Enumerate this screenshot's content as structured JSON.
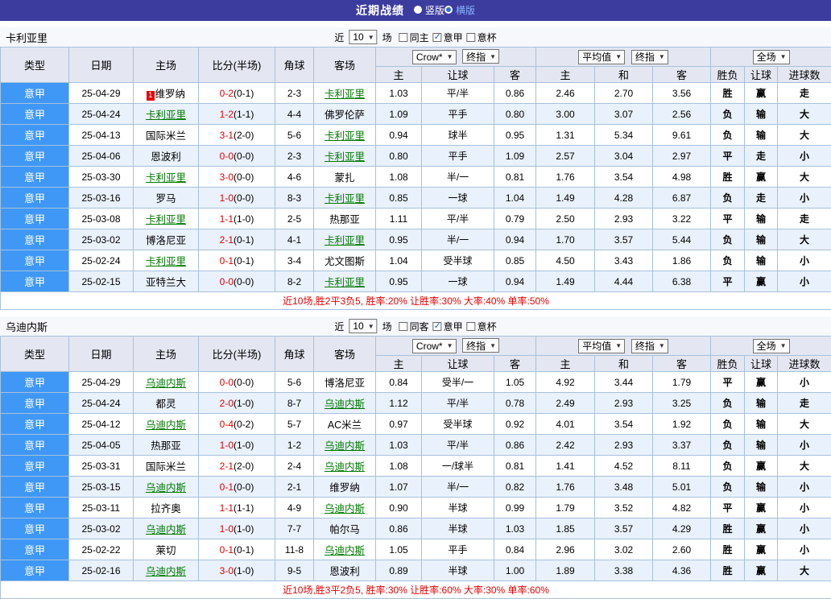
{
  "topbar": {
    "title": "近期战绩",
    "modes": [
      {
        "label": "竖版",
        "selected": false
      },
      {
        "label": "横版",
        "selected": true
      }
    ]
  },
  "controls": {
    "near": "近",
    "count": "10",
    "games": "场"
  },
  "table_head": {
    "type": "类型",
    "date": "日期",
    "home": "主场",
    "score": "比分(半场)",
    "corner": "角球",
    "away": "客场",
    "dropdown_bookmaker": "Crow*",
    "dropdown_final": "终指",
    "dropdown_average": "平均值",
    "dropdown_final2": "终指",
    "dropdown_fullmatch": "全场",
    "sub": [
      "主",
      "让球",
      "客",
      "主",
      "和",
      "客",
      "胜负",
      "让球",
      "进球数"
    ]
  },
  "colors": {
    "accent_bar": "#3c3c9e",
    "league_bg": "#3f98f6",
    "win": "#e60012",
    "lose": "#2525cc",
    "draw": "#00a04a",
    "focus_team": "#007a00",
    "summary": "#e60000"
  },
  "sections": [
    {
      "team": "卡利亚里",
      "filters": [
        {
          "label": "同主",
          "checked": false
        },
        {
          "label": "意甲",
          "checked": true
        },
        {
          "label": "意杯",
          "checked": false
        }
      ],
      "summary": "近10场,胜2平3负5, 胜率:20% 让胜率:30% 大率:40% 单率:50%",
      "rows": [
        {
          "league": "意甲",
          "date": "25-04-29",
          "home": {
            "name": "维罗纳",
            "focus": false,
            "badge": "1"
          },
          "score": "0-2",
          "half": "(0-1)",
          "corner": "2-3",
          "away": {
            "name": "卡利亚里",
            "focus": true
          },
          "odds": [
            "1.03",
            "平/半",
            "0.86"
          ],
          "avg": [
            "2.46",
            "2.70",
            "3.56"
          ],
          "result": [
            [
              "胜",
              "w"
            ],
            [
              "赢",
              "w"
            ],
            [
              "走",
              "d"
            ]
          ]
        },
        {
          "league": "意甲",
          "date": "25-04-24",
          "home": {
            "name": "卡利亚里",
            "focus": true
          },
          "score": "1-2",
          "half": "(1-1)",
          "corner": "4-4",
          "away": {
            "name": "佛罗伦萨",
            "focus": false
          },
          "odds": [
            "1.09",
            "平手",
            "0.80"
          ],
          "avg": [
            "3.00",
            "3.07",
            "2.56"
          ],
          "result": [
            [
              "负",
              "l"
            ],
            [
              "输",
              "l"
            ],
            [
              "大",
              "w"
            ]
          ]
        },
        {
          "league": "意甲",
          "date": "25-04-13",
          "home": {
            "name": "国际米兰",
            "focus": false
          },
          "score": "3-1",
          "half": "(2-0)",
          "corner": "5-6",
          "away": {
            "name": "卡利亚里",
            "focus": true
          },
          "odds": [
            "0.94",
            "球半",
            "0.95"
          ],
          "avg": [
            "1.31",
            "5.34",
            "9.61"
          ],
          "result": [
            [
              "负",
              "l"
            ],
            [
              "输",
              "l"
            ],
            [
              "大",
              "w"
            ]
          ]
        },
        {
          "league": "意甲",
          "date": "25-04-06",
          "home": {
            "name": "恩波利",
            "focus": false
          },
          "score": "0-0",
          "half": "(0-0)",
          "corner": "2-3",
          "away": {
            "name": "卡利亚里",
            "focus": true
          },
          "odds": [
            "0.80",
            "平手",
            "1.09"
          ],
          "avg": [
            "2.57",
            "3.04",
            "2.97"
          ],
          "result": [
            [
              "平",
              "d"
            ],
            [
              "走",
              "d"
            ],
            [
              "小",
              "l"
            ]
          ]
        },
        {
          "league": "意甲",
          "date": "25-03-30",
          "home": {
            "name": "卡利亚里",
            "focus": true
          },
          "score": "3-0",
          "half": "(0-0)",
          "corner": "4-6",
          "away": {
            "name": "蒙扎",
            "focus": false
          },
          "odds": [
            "1.08",
            "半/一",
            "0.81"
          ],
          "avg": [
            "1.76",
            "3.54",
            "4.98"
          ],
          "result": [
            [
              "胜",
              "w"
            ],
            [
              "赢",
              "w"
            ],
            [
              "大",
              "w"
            ]
          ]
        },
        {
          "league": "意甲",
          "date": "25-03-16",
          "home": {
            "name": "罗马",
            "focus": false
          },
          "score": "1-0",
          "half": "(0-0)",
          "corner": "8-3",
          "away": {
            "name": "卡利亚里",
            "focus": true
          },
          "odds": [
            "0.85",
            "一球",
            "1.04"
          ],
          "avg": [
            "1.49",
            "4.28",
            "6.87"
          ],
          "result": [
            [
              "负",
              "l"
            ],
            [
              "走",
              "d"
            ],
            [
              "小",
              "l"
            ]
          ]
        },
        {
          "league": "意甲",
          "date": "25-03-08",
          "home": {
            "name": "卡利亚里",
            "focus": true
          },
          "score": "1-1",
          "half": "(1-0)",
          "corner": "2-5",
          "away": {
            "name": "热那亚",
            "focus": false
          },
          "odds": [
            "1.11",
            "平/半",
            "0.79"
          ],
          "avg": [
            "2.50",
            "2.93",
            "3.22"
          ],
          "result": [
            [
              "平",
              "d"
            ],
            [
              "输",
              "l"
            ],
            [
              "走",
              "d"
            ]
          ]
        },
        {
          "league": "意甲",
          "date": "25-03-02",
          "home": {
            "name": "博洛尼亚",
            "focus": false
          },
          "score": "2-1",
          "half": "(0-1)",
          "corner": "4-1",
          "away": {
            "name": "卡利亚里",
            "focus": true
          },
          "odds": [
            "0.95",
            "半/一",
            "0.94"
          ],
          "avg": [
            "1.70",
            "3.57",
            "5.44"
          ],
          "result": [
            [
              "负",
              "l"
            ],
            [
              "输",
              "l"
            ],
            [
              "大",
              "w"
            ]
          ]
        },
        {
          "league": "意甲",
          "date": "25-02-24",
          "home": {
            "name": "卡利亚里",
            "focus": true
          },
          "score": "0-1",
          "half": "(0-1)",
          "corner": "3-4",
          "away": {
            "name": "尤文图斯",
            "focus": false
          },
          "odds": [
            "1.04",
            "受半球",
            "0.85"
          ],
          "avg": [
            "4.50",
            "3.43",
            "1.86"
          ],
          "result": [
            [
              "负",
              "l"
            ],
            [
              "输",
              "l"
            ],
            [
              "小",
              "l"
            ]
          ]
        },
        {
          "league": "意甲",
          "date": "25-02-15",
          "home": {
            "name": "亚特兰大",
            "focus": false
          },
          "score": "0-0",
          "half": "(0-0)",
          "corner": "8-2",
          "away": {
            "name": "卡利亚里",
            "focus": true
          },
          "odds": [
            "0.95",
            "一球",
            "0.94"
          ],
          "avg": [
            "1.49",
            "4.44",
            "6.38"
          ],
          "result": [
            [
              "平",
              "d"
            ],
            [
              "赢",
              "w"
            ],
            [
              "小",
              "l"
            ]
          ]
        }
      ]
    },
    {
      "team": "乌迪内斯",
      "filters": [
        {
          "label": "同客",
          "checked": false
        },
        {
          "label": "意甲",
          "checked": true
        },
        {
          "label": "意杯",
          "checked": false
        }
      ],
      "summary": "近10场,胜3平2负5, 胜率:30% 让胜率:60% 大率:30% 单率:60%",
      "rows": [
        {
          "league": "意甲",
          "date": "25-04-29",
          "home": {
            "name": "乌迪内斯",
            "focus": true
          },
          "score": "0-0",
          "half": "(0-0)",
          "corner": "5-6",
          "away": {
            "name": "博洛尼亚",
            "focus": false
          },
          "odds": [
            "0.84",
            "受半/一",
            "1.05"
          ],
          "avg": [
            "4.92",
            "3.44",
            "1.79"
          ],
          "result": [
            [
              "平",
              "d"
            ],
            [
              "赢",
              "w"
            ],
            [
              "小",
              "l"
            ]
          ]
        },
        {
          "league": "意甲",
          "date": "25-04-24",
          "home": {
            "name": "都灵",
            "focus": false
          },
          "score": "2-0",
          "half": "(1-0)",
          "corner": "8-7",
          "away": {
            "name": "乌迪内斯",
            "focus": true
          },
          "odds": [
            "1.12",
            "平/半",
            "0.78"
          ],
          "avg": [
            "2.49",
            "2.93",
            "3.25"
          ],
          "result": [
            [
              "负",
              "l"
            ],
            [
              "输",
              "l"
            ],
            [
              "走",
              "d"
            ]
          ]
        },
        {
          "league": "意甲",
          "date": "25-04-12",
          "home": {
            "name": "乌迪内斯",
            "focus": true
          },
          "score": "0-4",
          "half": "(0-2)",
          "corner": "5-7",
          "away": {
            "name": "AC米兰",
            "focus": false
          },
          "odds": [
            "0.97",
            "受半球",
            "0.92"
          ],
          "avg": [
            "4.01",
            "3.54",
            "1.92"
          ],
          "result": [
            [
              "负",
              "l"
            ],
            [
              "输",
              "l"
            ],
            [
              "大",
              "w"
            ]
          ]
        },
        {
          "league": "意甲",
          "date": "25-04-05",
          "home": {
            "name": "热那亚",
            "focus": false
          },
          "score": "1-0",
          "half": "(1-0)",
          "corner": "1-2",
          "away": {
            "name": "乌迪内斯",
            "focus": true
          },
          "odds": [
            "1.03",
            "平/半",
            "0.86"
          ],
          "avg": [
            "2.42",
            "2.93",
            "3.37"
          ],
          "result": [
            [
              "负",
              "l"
            ],
            [
              "输",
              "l"
            ],
            [
              "小",
              "l"
            ]
          ]
        },
        {
          "league": "意甲",
          "date": "25-03-31",
          "home": {
            "name": "国际米兰",
            "focus": false
          },
          "score": "2-1",
          "half": "(2-0)",
          "corner": "2-4",
          "away": {
            "name": "乌迪内斯",
            "focus": true
          },
          "odds": [
            "1.08",
            "一/球半",
            "0.81"
          ],
          "avg": [
            "1.41",
            "4.52",
            "8.11"
          ],
          "result": [
            [
              "负",
              "l"
            ],
            [
              "赢",
              "w"
            ],
            [
              "大",
              "w"
            ]
          ]
        },
        {
          "league": "意甲",
          "date": "25-03-15",
          "home": {
            "name": "乌迪内斯",
            "focus": true
          },
          "score": "0-1",
          "half": "(0-0)",
          "corner": "2-1",
          "away": {
            "name": "维罗纳",
            "focus": false
          },
          "odds": [
            "1.07",
            "半/一",
            "0.82"
          ],
          "avg": [
            "1.76",
            "3.48",
            "5.01"
          ],
          "result": [
            [
              "负",
              "l"
            ],
            [
              "输",
              "l"
            ],
            [
              "小",
              "l"
            ]
          ]
        },
        {
          "league": "意甲",
          "date": "25-03-11",
          "home": {
            "name": "拉齐奥",
            "focus": false
          },
          "score": "1-1",
          "half": "(1-1)",
          "corner": "4-9",
          "away": {
            "name": "乌迪内斯",
            "focus": true
          },
          "odds": [
            "0.90",
            "半球",
            "0.99"
          ],
          "avg": [
            "1.79",
            "3.52",
            "4.82"
          ],
          "result": [
            [
              "平",
              "d"
            ],
            [
              "赢",
              "w"
            ],
            [
              "小",
              "l"
            ]
          ]
        },
        {
          "league": "意甲",
          "date": "25-03-02",
          "home": {
            "name": "乌迪内斯",
            "focus": true
          },
          "score": "1-0",
          "half": "(1-0)",
          "corner": "7-7",
          "away": {
            "name": "帕尔马",
            "focus": false
          },
          "odds": [
            "0.86",
            "半球",
            "1.03"
          ],
          "avg": [
            "1.85",
            "3.57",
            "4.29"
          ],
          "result": [
            [
              "胜",
              "w"
            ],
            [
              "赢",
              "w"
            ],
            [
              "小",
              "l"
            ]
          ]
        },
        {
          "league": "意甲",
          "date": "25-02-22",
          "home": {
            "name": "莱切",
            "focus": false
          },
          "score": "0-1",
          "half": "(0-1)",
          "corner": "11-8",
          "away": {
            "name": "乌迪内斯",
            "focus": true
          },
          "odds": [
            "1.05",
            "平手",
            "0.84"
          ],
          "avg": [
            "2.96",
            "3.02",
            "2.60"
          ],
          "result": [
            [
              "胜",
              "w"
            ],
            [
              "赢",
              "w"
            ],
            [
              "小",
              "l"
            ]
          ]
        },
        {
          "league": "意甲",
          "date": "25-02-16",
          "home": {
            "name": "乌迪内斯",
            "focus": true
          },
          "score": "3-0",
          "half": "(1-0)",
          "corner": "9-5",
          "away": {
            "name": "恩波利",
            "focus": false
          },
          "odds": [
            "0.89",
            "半球",
            "1.00"
          ],
          "avg": [
            "1.89",
            "3.38",
            "4.36"
          ],
          "result": [
            [
              "胜",
              "w"
            ],
            [
              "赢",
              "w"
            ],
            [
              "大",
              "w"
            ]
          ]
        }
      ]
    }
  ]
}
